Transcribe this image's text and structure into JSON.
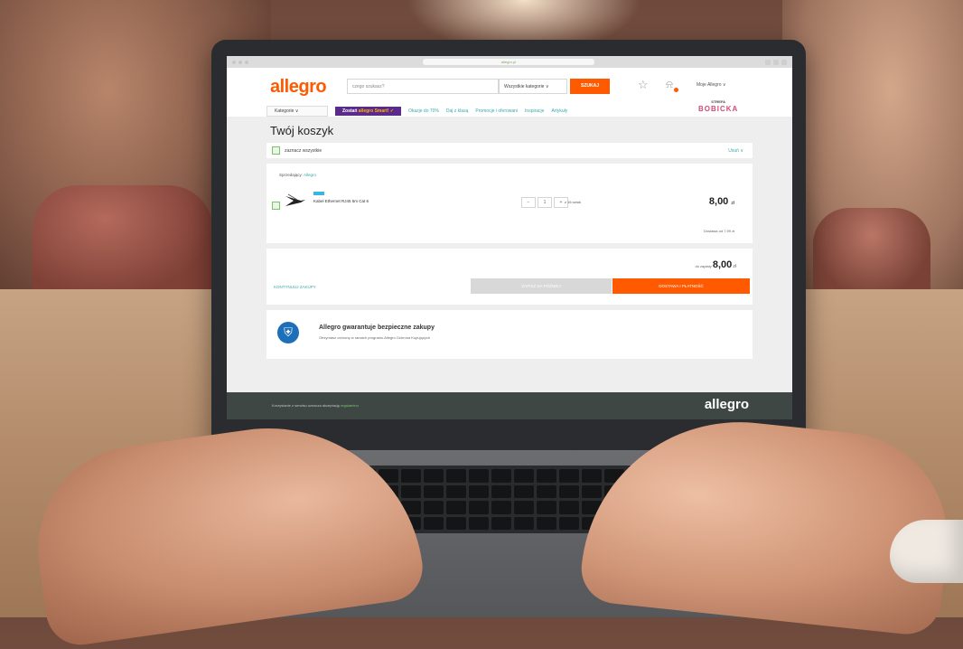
{
  "browser": {
    "url": "allegro.pl"
  },
  "header": {
    "logo": "allegro",
    "search_placeholder": "czego szukasz?",
    "category": "Wszystkie kategorie ∨",
    "search_button": "SZUKAJ",
    "account": "Moje Allegro ∨"
  },
  "nav": {
    "categories": "Kategorie ∨",
    "smart_prefix": "Zostań",
    "smart_brand": "allegro Smart! ✓",
    "links": [
      "Okazje do 70%",
      "Daj z klasą",
      "Promocje i oferowani",
      "Inspiracje",
      "Artykuły"
    ],
    "promo_top": "STREFA",
    "promo_name": "BOBICKA"
  },
  "cart": {
    "title": "Twój koszyk",
    "select_all": "zaznacz wszystkie",
    "delete": "Usuń ∨",
    "seller_label": "Sprzedający:",
    "seller_name": "Allegro",
    "item_name": "Kabel Ethernet RJ45 5m Cat 6",
    "qty_minus": "−",
    "qty_value": "1",
    "qty_plus": "+",
    "qty_note": "z 16 sztuk",
    "price": "8,00",
    "currency": "zł",
    "delivery": "Dostawa od 7,99 zł",
    "sum_label": "do zapłaty",
    "sum_value": "8,00",
    "continue": "KONTYNUUJ ZAKUPY",
    "btn_secondary": "ZAPISZ NA PÓŹNIEJ",
    "btn_primary": "DOSTAWA I PŁATNOŚĆ"
  },
  "guarantee": {
    "title": "Allegro gwarantuje bezpieczne zakupy",
    "text": "Otrzymasz ochronę w ramach programu Allegro Ochrona Kupujących"
  },
  "footer": {
    "text_prefix": "Korzystanie z serwisu oznacza akceptację",
    "text_link": "regulaminu",
    "logo": "allegro"
  }
}
